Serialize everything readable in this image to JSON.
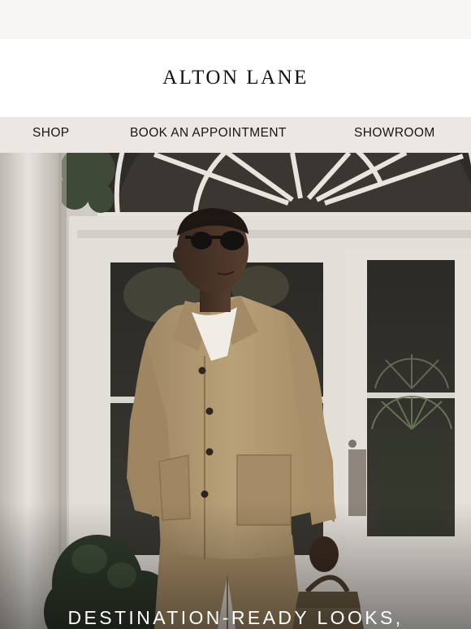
{
  "brand": {
    "name": "ALTON LANE"
  },
  "nav": {
    "items": [
      {
        "label": "SHOP"
      },
      {
        "label": "BOOK AN APPOINTMENT"
      },
      {
        "label": "SHOWROOM"
      }
    ]
  },
  "hero": {
    "headline": "DESTINATION-READY LOOKS,",
    "image_subject": "man in camel chore jacket and sunglasses at white doorway",
    "colors": {
      "jacket": "#b49a72",
      "door": "#e2ded8",
      "headline": "#ffffff"
    }
  },
  "colors": {
    "background": "#f7f6f5",
    "logo_bar": "#ffffff",
    "nav_bar": "#ece7e2",
    "text": "#161616"
  }
}
